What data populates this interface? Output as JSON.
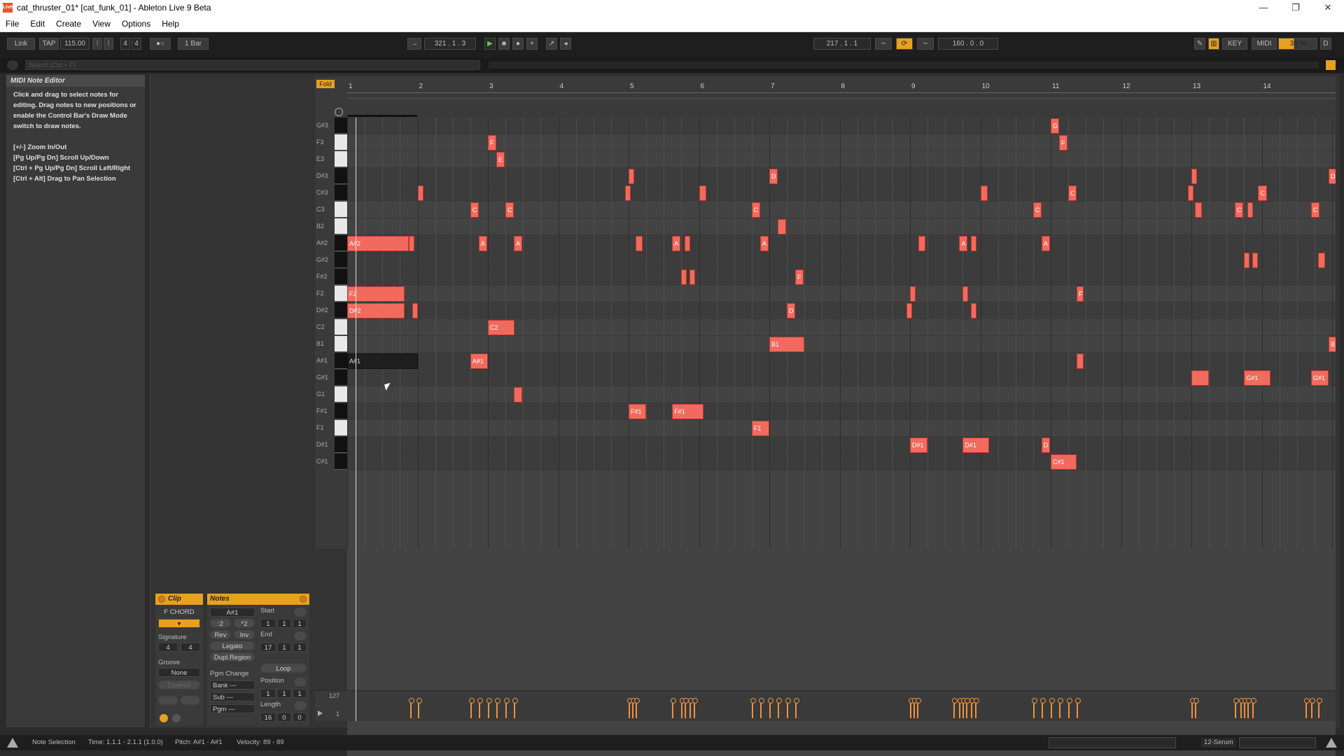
{
  "window": {
    "title": "cat_thruster_01* [cat_funk_01] - Ableton Live 9 Beta",
    "app_icon_text": "Live",
    "minimize": "—",
    "maximize": "❐",
    "close": "✕"
  },
  "menu": [
    "File",
    "Edit",
    "Create",
    "View",
    "Options",
    "Help"
  ],
  "control_bar": {
    "link": "Link",
    "tap": "TAP",
    "tempo": "115.00",
    "signature_num": "4",
    "signature_den": "4",
    "metronome": "1 Bar",
    "arrangement_position": "321 .  1 .  3",
    "loop_start": "217 .  1 .  1",
    "loop_length": "160 .  0 .  0",
    "key": "KEY",
    "midi": "MIDI",
    "cpu": "34 %",
    "d": "D"
  },
  "browser": {
    "search_placeholder": "Search (Ctrl + F)"
  },
  "info_panel": {
    "title": "MIDI Note Editor",
    "text": "Click and drag to select notes for editing. Drag notes to new positions or enable the Control Bar's Draw Mode switch to draw notes.\n\n[+/-] Zoom In/Out\n[Pg Up/Pg Dn] Scroll Up/Down\n[Ctrl + Pg Up/Pg Dn] Scroll Left/Right\n[Ctrl + Alt] Drag to Pan Selection"
  },
  "clip_panel": {
    "title": "Clip",
    "name": "F CHORD",
    "signature_label": "Signature",
    "sig_num": "4",
    "sig_den": "4",
    "groove_label": "Groove",
    "groove_value": "None",
    "commit": "Commit"
  },
  "notes_panel": {
    "title": "Notes",
    "pitch_range": "A#1",
    "div2": ":2",
    "mul2": "*2",
    "rev": "Rev",
    "inv": "Inv",
    "legato": "Legato",
    "dupl_region": "Dupl.Region",
    "pgm_change": "Pgm Change",
    "bank": "Bank ---",
    "sub": "Sub ---",
    "pgm": "Pgm ---",
    "start_label": "Start",
    "start": [
      "1",
      "1",
      "1"
    ],
    "end_label": "End",
    "end": [
      "17",
      "1",
      "1"
    ],
    "loop": "Loop",
    "position_label": "Position",
    "position": [
      "1",
      "1",
      "1"
    ],
    "length_label": "Length",
    "length": [
      "16",
      "0",
      "0"
    ]
  },
  "piano_roll": {
    "fold": "Fold",
    "bars": [
      "1",
      "2",
      "3",
      "4",
      "5",
      "6",
      "7",
      "8",
      "9",
      "10",
      "11",
      "12",
      "13",
      "14"
    ],
    "keys": [
      "G#3",
      "F3",
      "E3",
      "D#3",
      "C#3",
      "C3",
      "B2",
      "A#2",
      "G#2",
      "F#2",
      "F2",
      "D#2",
      "C2",
      "B1",
      "A#1",
      "G#1",
      "G1",
      "F#1",
      "F1",
      "D#1",
      "C#1"
    ],
    "velocity_max": "127",
    "velocity_min": "1",
    "notes": [
      {
        "key": 0,
        "start": 10.0,
        "len": 0.12,
        "label": "G"
      },
      {
        "key": 1,
        "start": 2.0,
        "len": 0.12,
        "label": "F"
      },
      {
        "key": 1,
        "start": 10.12,
        "len": 0.12,
        "label": "F"
      },
      {
        "key": 2,
        "start": 2.12,
        "len": 0.12,
        "label": "E"
      },
      {
        "key": 3,
        "start": 4.0,
        "len": 0.06,
        "label": ""
      },
      {
        "key": 3,
        "start": 6.0,
        "len": 0.12,
        "label": "D"
      },
      {
        "key": 3,
        "start": 12.0,
        "len": 0.06,
        "label": ""
      },
      {
        "key": 3,
        "start": 13.95,
        "len": 0.12,
        "label": "D"
      },
      {
        "key": 4,
        "start": 1.0,
        "len": 0.08,
        "label": ""
      },
      {
        "key": 4,
        "start": 3.95,
        "len": 0.06,
        "label": ""
      },
      {
        "key": 4,
        "start": 5.0,
        "len": 0.1,
        "label": ""
      },
      {
        "key": 4,
        "start": 9.0,
        "len": 0.1,
        "label": ""
      },
      {
        "key": 4,
        "start": 10.25,
        "len": 0.12,
        "label": "C"
      },
      {
        "key": 4,
        "start": 11.95,
        "len": 0.06,
        "label": ""
      },
      {
        "key": 4,
        "start": 12.95,
        "len": 0.12,
        "label": "C"
      },
      {
        "key": 5,
        "start": 1.75,
        "len": 0.12,
        "label": "C"
      },
      {
        "key": 5,
        "start": 2.25,
        "len": 0.12,
        "label": "C"
      },
      {
        "key": 5,
        "start": 5.75,
        "len": 0.12,
        "label": "C"
      },
      {
        "key": 5,
        "start": 9.75,
        "len": 0.12,
        "label": "C"
      },
      {
        "key": 5,
        "start": 12.05,
        "len": 0.1,
        "label": ""
      },
      {
        "key": 5,
        "start": 12.62,
        "len": 0.12,
        "label": "C"
      },
      {
        "key": 5,
        "start": 12.8,
        "len": 0.06,
        "label": ""
      },
      {
        "key": 5,
        "start": 13.7,
        "len": 0.12,
        "label": "C"
      },
      {
        "key": 6,
        "start": 6.12,
        "len": 0.12,
        "label": ""
      },
      {
        "key": 7,
        "start": 0.0,
        "len": 0.88,
        "label": "A#2"
      },
      {
        "key": 7,
        "start": 0.88,
        "len": 0.06,
        "label": ""
      },
      {
        "key": 7,
        "start": 1.87,
        "len": 0.12,
        "label": "A"
      },
      {
        "key": 7,
        "start": 2.37,
        "len": 0.12,
        "label": "A"
      },
      {
        "key": 7,
        "start": 4.1,
        "len": 0.1,
        "label": ""
      },
      {
        "key": 7,
        "start": 4.62,
        "len": 0.12,
        "label": "A"
      },
      {
        "key": 7,
        "start": 4.8,
        "len": 0.06,
        "label": ""
      },
      {
        "key": 7,
        "start": 5.87,
        "len": 0.12,
        "label": "A"
      },
      {
        "key": 7,
        "start": 8.12,
        "len": 0.1,
        "label": ""
      },
      {
        "key": 7,
        "start": 8.7,
        "len": 0.12,
        "label": "A"
      },
      {
        "key": 7,
        "start": 8.87,
        "len": 0.06,
        "label": ""
      },
      {
        "key": 7,
        "start": 9.87,
        "len": 0.12,
        "label": "A"
      },
      {
        "key": 8,
        "start": 12.75,
        "len": 0.06,
        "label": ""
      },
      {
        "key": 8,
        "start": 12.87,
        "len": 0.06,
        "label": ""
      },
      {
        "key": 8,
        "start": 13.8,
        "len": 0.1,
        "label": ""
      },
      {
        "key": 9,
        "start": 4.75,
        "len": 0.06,
        "label": ""
      },
      {
        "key": 9,
        "start": 4.87,
        "len": 0.06,
        "label": ""
      },
      {
        "key": 9,
        "start": 6.37,
        "len": 0.12,
        "label": "F"
      },
      {
        "key": 10,
        "start": 0.0,
        "len": 0.82,
        "label": "F2"
      },
      {
        "key": 10,
        "start": 8.0,
        "len": 0.06,
        "label": ""
      },
      {
        "key": 10,
        "start": 8.75,
        "len": 0.06,
        "label": ""
      },
      {
        "key": 10,
        "start": 10.37,
        "len": 0.1,
        "label": "F"
      },
      {
        "key": 11,
        "start": 0.0,
        "len": 0.82,
        "label": "D#2"
      },
      {
        "key": 11,
        "start": 0.93,
        "len": 0.06,
        "label": ""
      },
      {
        "key": 11,
        "start": 6.25,
        "len": 0.12,
        "label": "D"
      },
      {
        "key": 11,
        "start": 7.95,
        "len": 0.06,
        "label": ""
      },
      {
        "key": 11,
        "start": 8.87,
        "len": 0.06,
        "label": ""
      },
      {
        "key": 12,
        "start": 2.0,
        "len": 0.38,
        "label": "C2"
      },
      {
        "key": 13,
        "start": 6.0,
        "len": 0.5,
        "label": "B1"
      },
      {
        "key": 13,
        "start": 13.95,
        "len": 0.12,
        "label": "B1"
      },
      {
        "key": 14,
        "start": 0.0,
        "len": 1.0,
        "label": "A#1",
        "selected": true
      },
      {
        "key": 14,
        "start": 1.75,
        "len": 0.25,
        "label": "A#1"
      },
      {
        "key": 14,
        "start": 10.37,
        "len": 0.1,
        "label": ""
      },
      {
        "key": 15,
        "start": 12.0,
        "len": 0.25,
        "label": ""
      },
      {
        "key": 15,
        "start": 12.75,
        "len": 0.37,
        "label": "G#1"
      },
      {
        "key": 15,
        "start": 13.7,
        "len": 0.25,
        "label": "G#1"
      },
      {
        "key": 16,
        "start": 2.37,
        "len": 0.12,
        "label": ""
      },
      {
        "key": 17,
        "start": 4.0,
        "len": 0.25,
        "label": "F#1"
      },
      {
        "key": 17,
        "start": 4.62,
        "len": 0.44,
        "label": "F#1"
      },
      {
        "key": 18,
        "start": 5.75,
        "len": 0.25,
        "label": "F1"
      },
      {
        "key": 19,
        "start": 8.0,
        "len": 0.25,
        "label": "D#1"
      },
      {
        "key": 19,
        "start": 8.75,
        "len": 0.37,
        "label": "D#1"
      },
      {
        "key": 19,
        "start": 9.87,
        "len": 0.12,
        "label": "D"
      },
      {
        "key": 20,
        "start": 10.0,
        "len": 0.37,
        "label": "C#1"
      }
    ],
    "velocity_groups": [
      0.9,
      1.0,
      1.75,
      1.87,
      2.0,
      2.12,
      2.25,
      2.37,
      4.0,
      4.05,
      4.1,
      4.62,
      4.75,
      4.8,
      4.87,
      4.93,
      5.75,
      5.87,
      6.0,
      6.12,
      6.25,
      6.37,
      8.0,
      8.05,
      8.1,
      8.62,
      8.7,
      8.75,
      8.8,
      8.87,
      8.93,
      9.75,
      9.87,
      10.0,
      10.12,
      10.25,
      10.37,
      12.0,
      12.05,
      12.62,
      12.7,
      12.75,
      12.8,
      12.87,
      13.62,
      13.7,
      13.8
    ]
  },
  "status_bar": {
    "mode": "Note Selection",
    "time": "Time: 1.1.1 - 2.1.1 (1.0.0)",
    "pitch": "Pitch: A#1 - A#1",
    "velocity": "Velocity: 89 - 89",
    "track": "12-Serum"
  }
}
